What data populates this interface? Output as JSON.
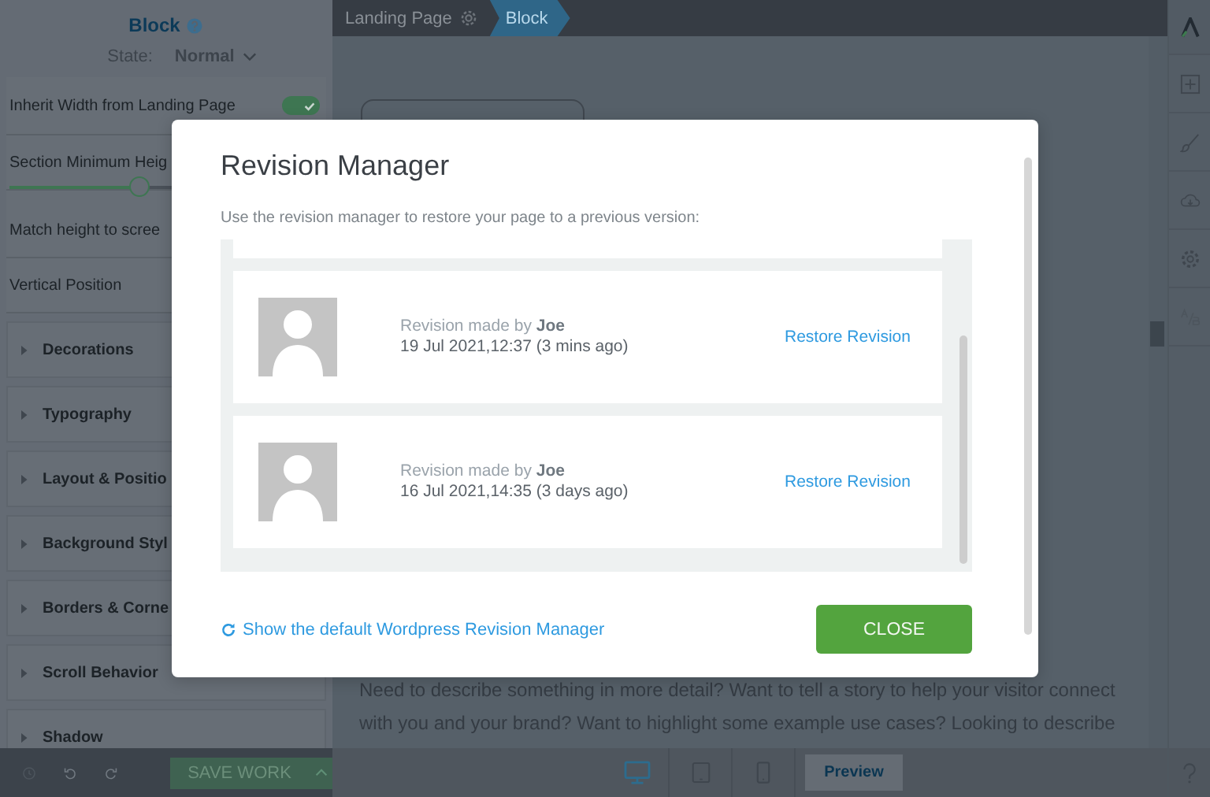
{
  "sidebar": {
    "title": "Block",
    "state_label": "State:",
    "state_value": "Normal",
    "settings": [
      {
        "kind": "toggle",
        "label": "Inherit Width from Landing Page",
        "on": true
      },
      {
        "kind": "label",
        "label": "Section Minimum Heig"
      },
      {
        "kind": "slider",
        "level": 0.42
      },
      {
        "kind": "label",
        "label": "Match height to scree"
      },
      {
        "kind": "label",
        "label": "Vertical Position"
      }
    ],
    "sections": [
      {
        "label": "Decorations",
        "expanded": false
      },
      {
        "label": "Typography",
        "expanded": false
      },
      {
        "label": "Layout & Positio",
        "expanded": false
      },
      {
        "label": "Background Styl",
        "expanded": false
      },
      {
        "label": "Borders & Corne",
        "expanded": false
      },
      {
        "label": "Scroll Behavior",
        "expanded": false
      },
      {
        "label": "Shadow",
        "expanded": false
      }
    ],
    "save_button": "SAVE WORK"
  },
  "breadcrumb": [
    {
      "label": "Landing Page",
      "selected": false
    },
    {
      "label": "Block",
      "selected": true
    }
  ],
  "canvas": {
    "paragraph_lines": [
      "Need to describe something in more detail? Want to tell a story to help your visitor connect",
      "with you and your brand? Want to highlight some example use cases? Looking to describe"
    ]
  },
  "devices": [
    {
      "kind": "desktop",
      "selected": true
    },
    {
      "kind": "tablet",
      "selected": false
    },
    {
      "kind": "phone",
      "selected": false
    }
  ],
  "preview_button": "Preview",
  "modal": {
    "title": "Revision Manager",
    "description": "Use the revision manager to restore your page to a previous version:",
    "revisions": [
      {
        "author_line": "Revision made by **Joe**",
        "date": "19 Jul 2021,12:37 (3 mins ago)",
        "action": "Restore Revision"
      },
      {
        "author_line": "Revision made by **Joe**",
        "date": "16 Jul 2021,14:35 (3 days ago)",
        "action": "Restore Revision"
      }
    ],
    "footer_link": "Show the default Wordpress Revision Manager",
    "close_button": "CLOSE"
  }
}
